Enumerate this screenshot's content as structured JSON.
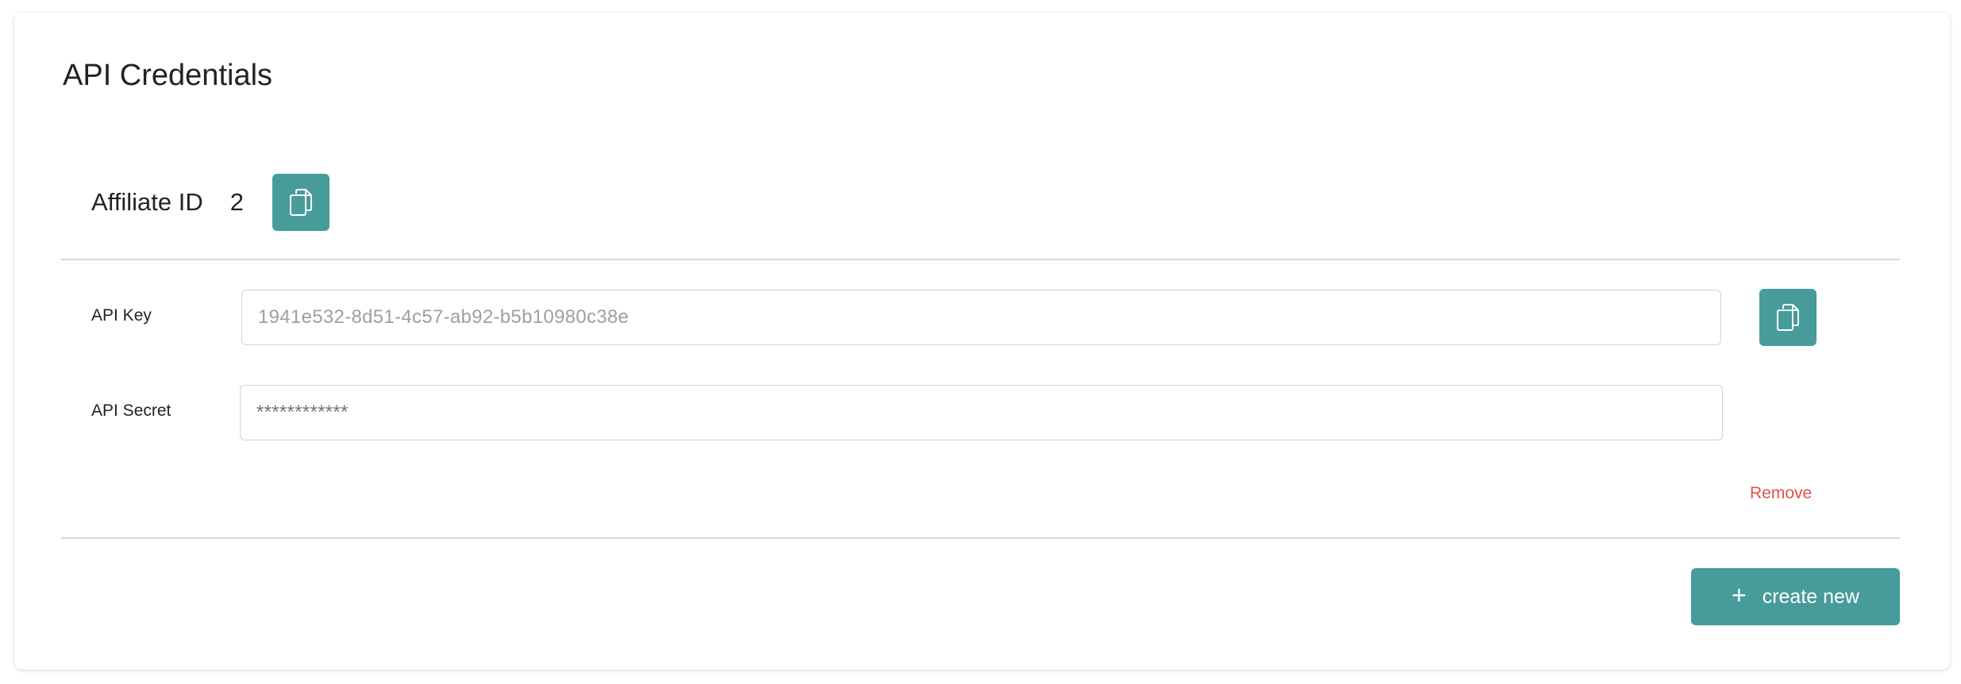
{
  "page": {
    "title": "API Credentials"
  },
  "affiliate": {
    "label": "Affiliate ID",
    "value": "2"
  },
  "credentials": {
    "api_key_label": "API Key",
    "api_key_value": "1941e532-8d51-4c57-ab92-b5b10980c38e",
    "api_secret_label": "API Secret",
    "api_secret_placeholder": "************",
    "remove_label": "Remove"
  },
  "actions": {
    "create_new_label": "create new",
    "create_new_icon": "plus-icon",
    "copy_icon": "copy-icon"
  },
  "colors": {
    "accent": "#479b9b",
    "danger": "#e0524d",
    "text": "#1f2328",
    "placeholder": "#9aa0a6",
    "divider": "#d6d8da"
  }
}
